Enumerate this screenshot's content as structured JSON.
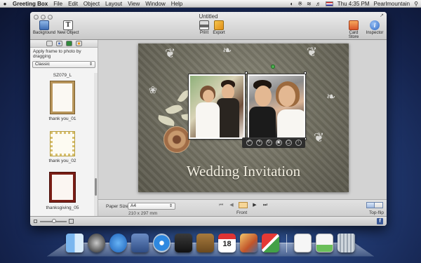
{
  "menubar": {
    "app_name": "Greeting Box",
    "menus": [
      "File",
      "Edit",
      "Object",
      "Layout",
      "View",
      "Window",
      "Help"
    ],
    "clock": "Thu 4:35 PM",
    "user": "Pearlmountain"
  },
  "window": {
    "title": "Untitled",
    "toolbar": {
      "background": "Background",
      "new_object": "New Object",
      "new_object_glyph": "T",
      "print": "Print",
      "export": "Export",
      "card_store": "Card Store",
      "inspector": "Inspector",
      "inspector_glyph": "i"
    }
  },
  "sidebar": {
    "hint": "Apply frame to photo by dragging",
    "category": "Classic",
    "frames": [
      {
        "label": "SZ079_L"
      },
      {
        "label": "thank you_01",
        "color": "#b8955a"
      },
      {
        "label": "thank you_02",
        "color": "#d8c070"
      },
      {
        "label": "thanksgiving_05",
        "color": "#7a1e16"
      }
    ]
  },
  "canvas": {
    "title": "Wedding Invitation",
    "overlay_buttons": [
      "↶",
      "↷",
      "↻",
      "▣",
      "▢",
      "↑"
    ]
  },
  "bottombar": {
    "paper_size_label": "Paper Size:",
    "paper_size": "A4",
    "paper_dims": "210 x 297 mm",
    "side": "Front",
    "flip_label": "Top-flip"
  },
  "footer": {
    "fb_glyph": "f"
  },
  "colors": {
    "desktop": "#243f7a",
    "page_background": "#6e6c5e",
    "accent_blue": "#2d67c4"
  }
}
